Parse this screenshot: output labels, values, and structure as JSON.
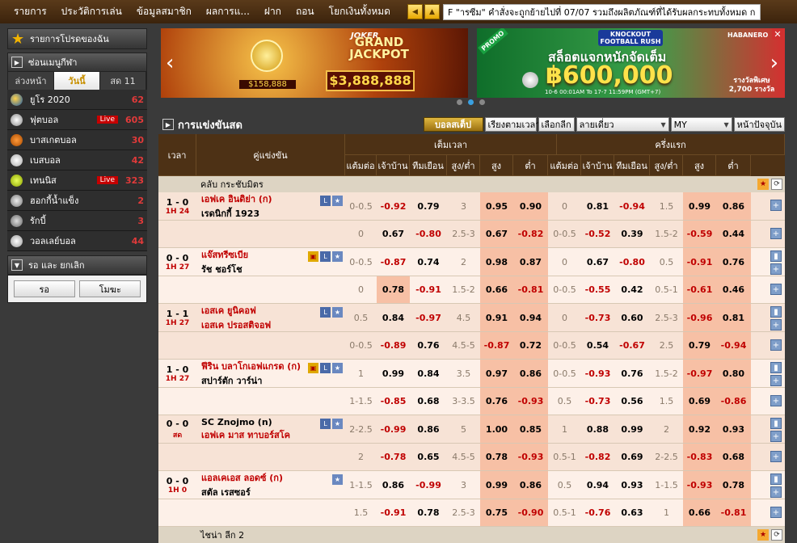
{
  "topnav": {
    "items": [
      "รายการ",
      "ประวัติการเล่น",
      "ข้อมูลสมาชิก",
      "ผลการแ...",
      "ฝาก",
      "ถอน",
      "โยกเงินทั้งหมด"
    ],
    "marquee": "F \"ารซีม\" คำสั่งจะถูกย้ายไปที่ 07/07 รวมถึงผลิตภัณฑ์ที่ได้รับผลกระทบทั้งหมด ก"
  },
  "sidebar": {
    "favorites": "รายการโปรดของฉัน",
    "hide_menu": "ซ่อนเมนูกีฬา",
    "tabs": [
      "ล่วงหน้า",
      "วันนี้",
      "สด 11"
    ],
    "sports": [
      {
        "name": "ยูโร 2020",
        "count": "62",
        "live": false
      },
      {
        "name": "ฟุตบอล",
        "count": "605",
        "live": true
      },
      {
        "name": "บาสเกตบอล",
        "count": "30",
        "live": false
      },
      {
        "name": "เบสบอล",
        "count": "42",
        "live": false
      },
      {
        "name": "เทนนิส",
        "count": "323",
        "live": true
      },
      {
        "name": "ฮอกกี้น้ำแข็ง",
        "count": "2",
        "live": false
      },
      {
        "name": "รักบี้",
        "count": "3",
        "live": false
      },
      {
        "name": "วอลเลย์บอล",
        "count": "44",
        "live": false
      }
    ],
    "live_label": "Live",
    "wait_section": "รอ และ ยกเลิก",
    "wait_btn": "รอ",
    "cancel_btn": "โมฆะ"
  },
  "banners": {
    "b1": {
      "brand": "JOKER",
      "title": "GRAND JACKPOT",
      "amount": "$3,888,888",
      "amount2": "$158,888"
    },
    "b2": {
      "tag": "PROMO",
      "game": "KNOCKOUT FOOTBALL RUSH",
      "brand": "HABANERO",
      "headline": "สล็อตแจกหนักจัดเต็ม",
      "amount": "฿600,000",
      "sub": "รางวัลพิเศษ 2,700 รางวัล",
      "date": "10-6 00:01AM To 17-7 11:59PM (GMT+7)"
    }
  },
  "main": {
    "title": "การแข่งขันสด",
    "buttons": [
      "บอลสเต็ป",
      "เรียงตามเวลา",
      "เลือกลีก",
      "ลายเดี่ยว",
      "MY",
      "หน้าปัจจุบัน"
    ]
  },
  "header": {
    "time": "เวลา",
    "match": "คู่แข่งขัน",
    "fulltime": "เต็มเวลา",
    "halftime": "ครึ่งแรก",
    "cols": [
      "แต้มต่อ",
      "เจ้าบ้าน",
      "ทีมเยือน",
      "สูง/ต่ำ",
      "สูง",
      "ต่ำ",
      "แต้มต่อ",
      "เจ้าบ้าน",
      "ทีมเยือน",
      "สูง/ต่ำ",
      "สูง",
      "ต่ำ"
    ]
  },
  "leagues": [
    {
      "name": "คลับ กระชับมิตร"
    },
    {
      "name": "ไชน่า ลีก 2"
    }
  ],
  "matches": [
    {
      "score": "1 - 0",
      "time": "1H 24",
      "home": "เอฟเค อินดิย่า (ก)",
      "away": "เรดนิกกี้ 1923",
      "home_red": true,
      "away_red": false,
      "rows": [
        [
          "0-0.5",
          "-0.92",
          "0.79",
          "3",
          "0.95",
          "0.90",
          "0",
          "0.81",
          "-0.94",
          "1.5",
          "0.99",
          "0.86"
        ],
        [
          "0",
          "0.67",
          "-0.80",
          "2.5-3",
          "0.67",
          "-0.82",
          "0-0.5",
          "-0.52",
          "0.39",
          "1.5-2",
          "-0.59",
          "0.44"
        ]
      ]
    },
    {
      "score": "0 - 0",
      "time": "1H 27",
      "home": "แจ๊สทรีซเบีย",
      "away": "รัช ชอร์โช",
      "home_red": true,
      "away_red": false,
      "rows": [
        [
          "0-0.5",
          "-0.87",
          "0.74",
          "2",
          "0.98",
          "0.87",
          "0",
          "0.67",
          "-0.80",
          "0.5",
          "-0.91",
          "0.76"
        ],
        [
          "0",
          "0.78",
          "-0.91",
          "1.5-2",
          "0.66",
          "-0.81",
          "0-0.5",
          "-0.55",
          "0.42",
          "0.5-1",
          "-0.61",
          "0.46"
        ]
      ]
    },
    {
      "score": "1 - 1",
      "time": "1H 27",
      "home": "เอสเค ยูนิคอฟ",
      "away": "เอสเค ปรอสติจอฟ",
      "home_red": true,
      "away_red": true,
      "rows": [
        [
          "0.5",
          "0.84",
          "-0.97",
          "4.5",
          "0.91",
          "0.94",
          "0",
          "-0.73",
          "0.60",
          "2.5-3",
          "-0.96",
          "0.81"
        ],
        [
          "0-0.5",
          "-0.89",
          "0.76",
          "4.5-5",
          "-0.87",
          "0.72",
          "0-0.5",
          "0.54",
          "-0.67",
          "2.5",
          "0.79",
          "-0.94"
        ]
      ]
    },
    {
      "score": "1 - 0",
      "time": "1H 27",
      "home": "ฟีริน บลาโกเอฟแกรด (ก)",
      "away": "สปาร์ตัก วาร์น่า",
      "home_red": true,
      "away_red": false,
      "rows": [
        [
          "1",
          "0.99",
          "0.84",
          "3.5",
          "0.97",
          "0.86",
          "0-0.5",
          "-0.93",
          "0.76",
          "1.5-2",
          "-0.97",
          "0.80"
        ],
        [
          "1-1.5",
          "-0.85",
          "0.68",
          "3-3.5",
          "0.76",
          "-0.93",
          "0.5",
          "-0.73",
          "0.56",
          "1.5",
          "0.69",
          "-0.86"
        ]
      ]
    },
    {
      "score": "0 - 0",
      "time": "สด",
      "home": "SC Znojmo (n)",
      "away": "เอฟเค มาส ทาบอร์สโค",
      "home_red": false,
      "away_red": true,
      "rows": [
        [
          "2-2.5",
          "-0.99",
          "0.86",
          "5",
          "1.00",
          "0.85",
          "1",
          "0.88",
          "0.99",
          "2",
          "0.92",
          "0.93"
        ],
        [
          "2",
          "-0.78",
          "0.65",
          "4.5-5",
          "0.78",
          "-0.93",
          "0.5-1",
          "-0.82",
          "0.69",
          "2-2.5",
          "-0.83",
          "0.68"
        ]
      ]
    },
    {
      "score": "0 - 0",
      "time": "1H 0",
      "home": "แอลเคเอส ลอดซ์ (ก)",
      "away": "สตัล เรสซอร์",
      "home_red": true,
      "away_red": false,
      "rows": [
        [
          "1-1.5",
          "0.86",
          "-0.99",
          "3",
          "0.99",
          "0.86",
          "0.5",
          "0.94",
          "0.93",
          "1-1.5",
          "-0.93",
          "0.78"
        ],
        [
          "1.5",
          "-0.91",
          "0.78",
          "2.5-3",
          "0.75",
          "-0.90",
          "0.5-1",
          "-0.76",
          "0.63",
          "1",
          "0.66",
          "-0.81"
        ]
      ]
    }
  ],
  "colors": {
    "accent": "#c89000",
    "header": "#4d3115",
    "row_bg": "#f7e3d6",
    "hot": "#f7b89c",
    "negative": "#c00000"
  }
}
